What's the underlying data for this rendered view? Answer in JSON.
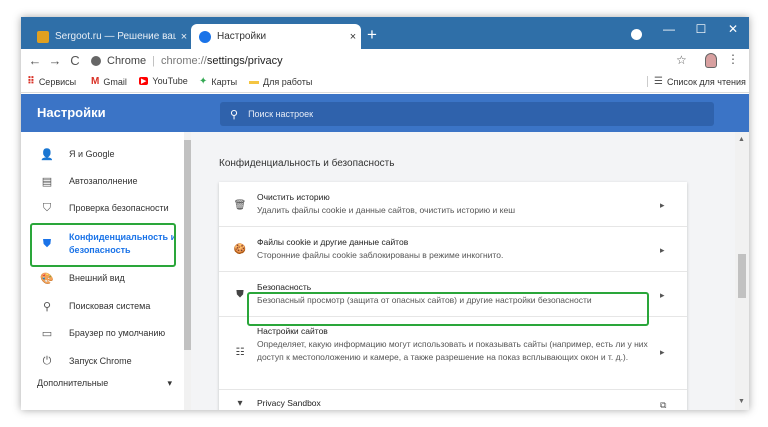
{
  "tabs": [
    {
      "title": "Sergoot.ru — Решение ваших п",
      "close": "×",
      "favicon_color": "#e0a020"
    },
    {
      "title": "Настройки",
      "close": "×",
      "favicon_color": "#1a73e8"
    }
  ],
  "newtab_label": "+",
  "window": {
    "minimize": "—",
    "maximize": "☐",
    "close": "✕"
  },
  "nav": {
    "back": "←",
    "forward": "→",
    "reload": "C"
  },
  "address": {
    "site": "Chrome",
    "url_prefix": "chrome://",
    "url_path": "settings/privacy"
  },
  "star": "☆",
  "kebab": "⋮",
  "bookmarks": {
    "items": [
      {
        "label": "Сервисы",
        "icon": "apps-grid-icon",
        "glyph": "⠿",
        "color": "#d93025"
      },
      {
        "label": "Gmail",
        "icon": "gmail-icon",
        "glyph": "M",
        "color": "#d93025"
      },
      {
        "label": "YouTube",
        "icon": "youtube-icon",
        "glyph": "▶",
        "color": "#ff0000"
      },
      {
        "label": "Карты",
        "icon": "maps-icon",
        "glyph": "✦",
        "color": "#34a853"
      },
      {
        "label": "Для работы",
        "icon": "folder-icon",
        "glyph": "▬",
        "color": "#f4c542"
      }
    ],
    "reading_list": {
      "label": "Список для чтения",
      "glyph": "☰"
    }
  },
  "header": {
    "title": "Настройки",
    "search_placeholder": "Поиск настроек",
    "search_glyph": "⚲"
  },
  "sidebar": {
    "items": [
      {
        "label": "Я и Google",
        "glyph": "👤"
      },
      {
        "label": "Автозаполнение",
        "glyph": "▤"
      },
      {
        "label": "Проверка безопасности",
        "glyph": "⛉"
      },
      {
        "label": "Конфиденциальность и",
        "label2": "безопасность",
        "glyph": "⛊"
      },
      {
        "label": "Внешний вид",
        "glyph": "🎨"
      },
      {
        "label": "Поисковая система",
        "glyph": "⚲"
      },
      {
        "label": "Браузер по умолчанию",
        "glyph": "▭"
      },
      {
        "label": "Запуск Chrome",
        "glyph": "⏻"
      }
    ],
    "more_label": "Дополнительные",
    "more_glyph": "▾"
  },
  "main": {
    "section_title": "Конфиденциальность и безопасность",
    "rows": [
      {
        "glyph": "🗑",
        "title": "Очистить историю",
        "desc": "Удалить файлы cookie и данные сайтов, очистить историю и кеш",
        "chev": "▸"
      },
      {
        "glyph": "🍪",
        "title": "Файлы cookie и другие данные сайтов",
        "desc": "Сторонние файлы cookie заблокированы в режиме инкогнито.",
        "chev": "▸"
      },
      {
        "glyph": "⛊",
        "title": "Безопасность",
        "desc": "Безопасный просмотр (защита от опасных сайтов) и другие настройки безопасности",
        "chev": "▸"
      },
      {
        "glyph": "☷",
        "title": "Настройки сайтов",
        "desc": "Определяет, какую информацию могут использовать и показывать сайты (например, есть ли у них доступ к местоположению и камере, а также разрешение на показ всплывающих окон и т. д.).",
        "chev": "▸"
      },
      {
        "glyph": "▾",
        "title": "Privacy Sandbox",
        "desc": "",
        "chev": "⧉"
      }
    ]
  },
  "highlight_color": "#2aa63a"
}
